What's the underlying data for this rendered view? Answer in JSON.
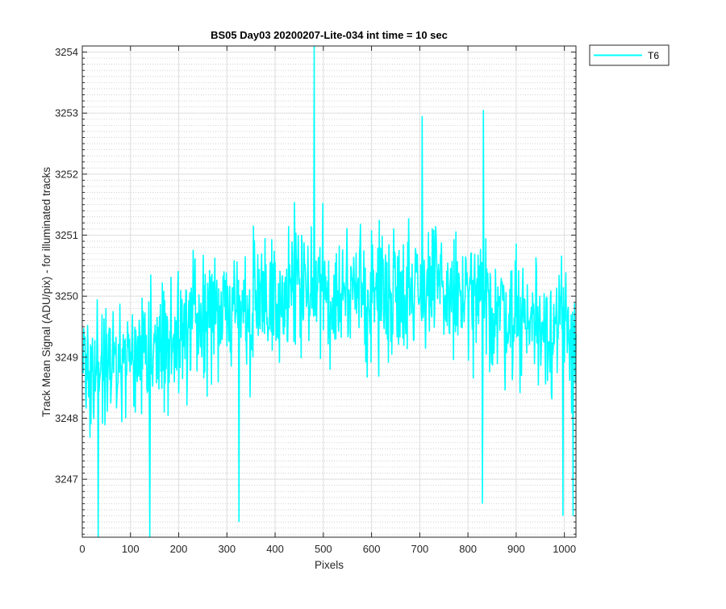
{
  "chart_data": {
    "type": "line",
    "title": "BS05 Day03 20200207-Lite-034 int time = 10 sec",
    "xlabel": "Pixels",
    "ylabel": "Track Mean Signal (ADU/pix) - for illuminated tracks",
    "xlim": [
      0,
      1024
    ],
    "ylim": [
      3246.05,
      3254.1
    ],
    "xticks": [
      0,
      100,
      200,
      300,
      400,
      500,
      600,
      700,
      800,
      900,
      1000
    ],
    "xtick_labels": [
      "0",
      "100",
      "200",
      "300",
      "400",
      "500",
      "600",
      "700",
      "800",
      "900",
      "1000"
    ],
    "yticks": [
      3247,
      3248,
      3249,
      3250,
      3251,
      3252,
      3253,
      3254
    ],
    "ytick_labels": [
      "3247",
      "3248",
      "3249",
      "3250",
      "3251",
      "3252",
      "3253",
      "3254"
    ],
    "grid": true,
    "minor_grid": true,
    "legend_position": "outside-top-right",
    "series": [
      {
        "name": "T6",
        "color": "#00FFFF",
        "x_start": 1,
        "x_end": 1024,
        "trend": [
          {
            "x": 0,
            "y": 3248.6
          },
          {
            "x": 100,
            "y": 3249.0
          },
          {
            "x": 200,
            "y": 3249.4
          },
          {
            "x": 300,
            "y": 3249.7
          },
          {
            "x": 400,
            "y": 3250.0
          },
          {
            "x": 500,
            "y": 3250.1
          },
          {
            "x": 600,
            "y": 3250.0
          },
          {
            "x": 700,
            "y": 3250.2
          },
          {
            "x": 800,
            "y": 3249.9
          },
          {
            "x": 900,
            "y": 3249.7
          },
          {
            "x": 1024,
            "y": 3249.4
          }
        ],
        "noise_amplitude": 0.75,
        "notable_points": [
          {
            "x": 33,
            "y": 3246.05
          },
          {
            "x": 140,
            "y": 3246.05
          },
          {
            "x": 325,
            "y": 3246.3
          },
          {
            "x": 481,
            "y": 3254.1
          },
          {
            "x": 705,
            "y": 3252.95
          },
          {
            "x": 832,
            "y": 3253.05
          },
          {
            "x": 830,
            "y": 3246.6
          },
          {
            "x": 997,
            "y": 3246.4
          },
          {
            "x": 1018,
            "y": 3246.4
          }
        ]
      }
    ]
  }
}
